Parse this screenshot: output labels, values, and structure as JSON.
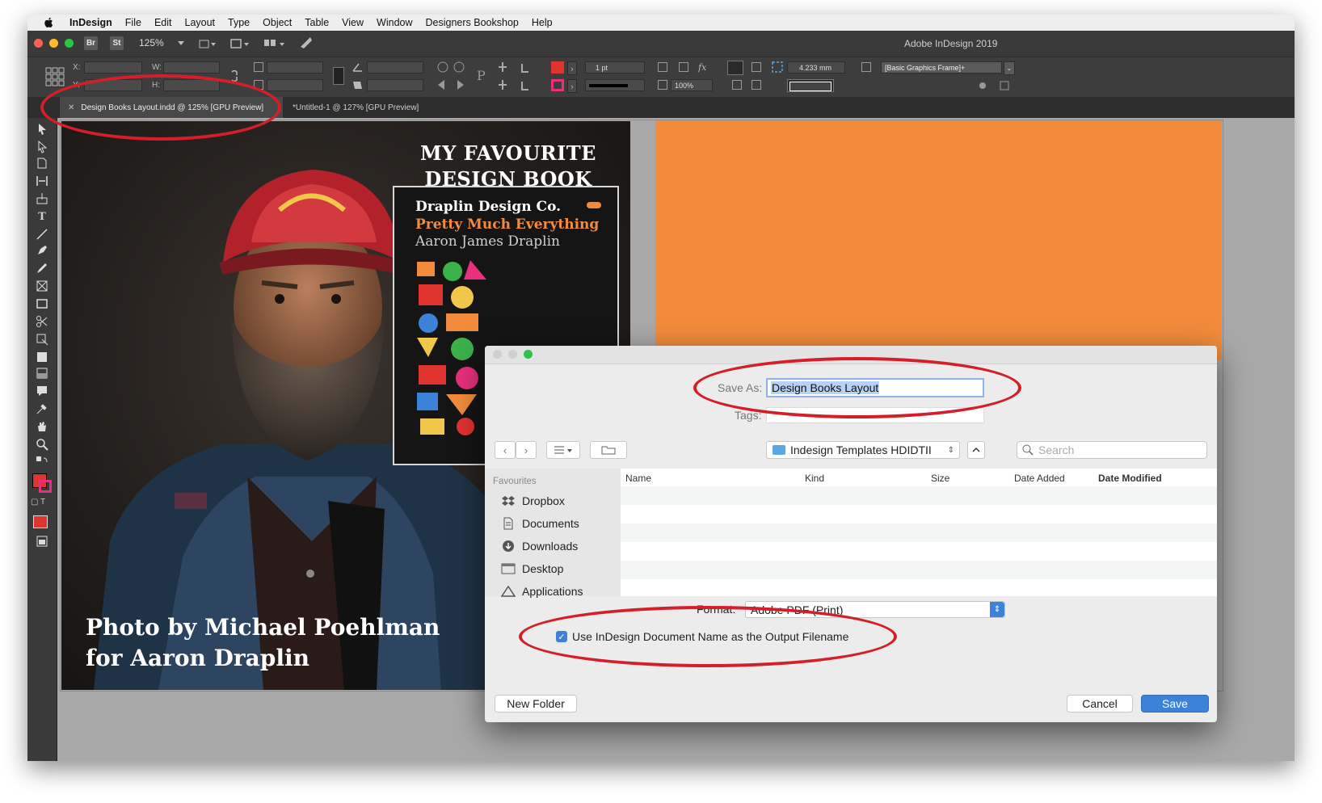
{
  "menubar": {
    "app": "InDesign",
    "items": [
      "File",
      "Edit",
      "Layout",
      "Type",
      "Object",
      "Table",
      "View",
      "Window",
      "Designers Bookshop",
      "Help"
    ]
  },
  "appbar": {
    "br_label": "Br",
    "st_label": "St",
    "zoom": "125%",
    "title": "Adobe InDesign 2019"
  },
  "control": {
    "x_label": "X:",
    "y_label": "Y:",
    "w_label": "W:",
    "h_label": "H:",
    "stroke_weight": "1 pt",
    "scale": "100%",
    "offset": "4.233 mm",
    "object_style": "[Basic Graphics Frame]+"
  },
  "tabs": [
    {
      "label": "Design Books Layout.indd @ 125% [GPU Preview]",
      "active": true
    },
    {
      "label": "*Untitled-1 @ 127% [GPU Preview]",
      "active": false
    }
  ],
  "document": {
    "headline_line1": "MY FAVOURITE",
    "headline_line2": "DESIGN BOOK",
    "book_title": "Draplin Design Co.",
    "book_subtitle": "Pretty Much Everything",
    "book_author": "Aaron James Draplin",
    "caption_line1": "Photo by Michael Poehlman",
    "caption_line2": "for Aaron Draplin"
  },
  "dialog": {
    "save_as_label": "Save As:",
    "save_as_value": "Design Books Layout",
    "tags_label": "Tags:",
    "location": "Indesign Templates HDIDTII",
    "search_placeholder": "Search",
    "sidebar_heading": "Favourites",
    "sidebar_items": [
      "Dropbox",
      "Documents",
      "Downloads",
      "Desktop",
      "Applications"
    ],
    "columns": [
      "Name",
      "Kind",
      "Size",
      "Date Added",
      "Date Modified"
    ],
    "format_label": "Format:",
    "format_value": "Adobe PDF (Print)",
    "checkbox_label": "Use InDesign Document Name as the Output Filename",
    "new_folder": "New Folder",
    "cancel": "Cancel",
    "save": "Save"
  },
  "colors": {
    "accent_blue": "#3b82d8",
    "annotation_red": "#d41f2a",
    "orange_page": "#f28c3c"
  }
}
